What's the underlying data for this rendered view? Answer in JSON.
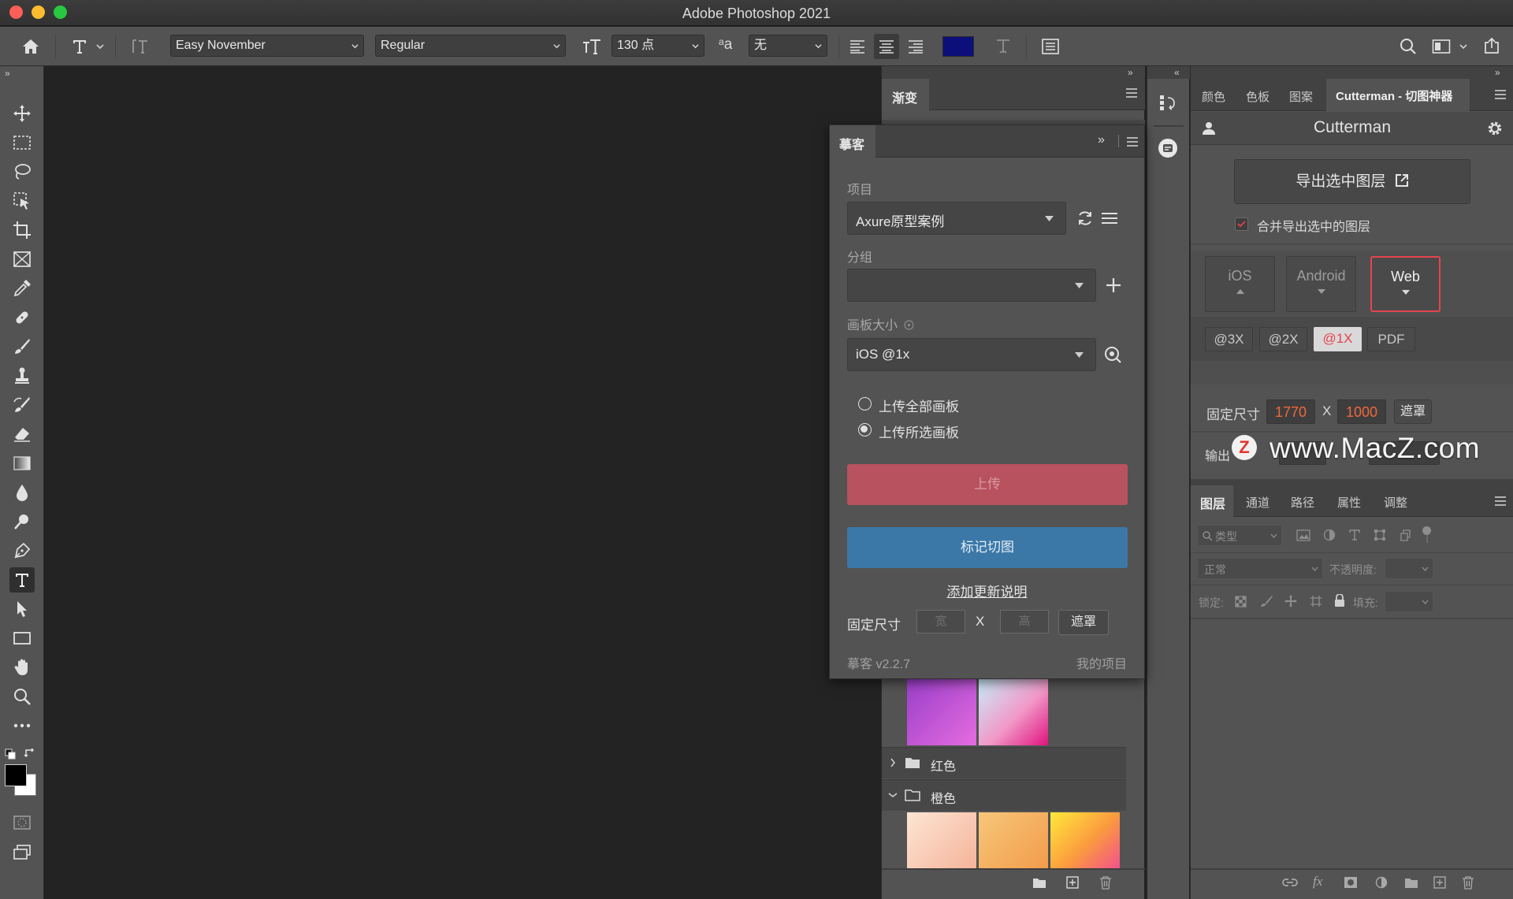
{
  "window": {
    "title": "Adobe Photoshop 2021"
  },
  "options_bar": {
    "font_family": "Easy November",
    "font_style": "Regular",
    "font_size": "130 点",
    "antialias_icon_label": "a",
    "antialias_value": "无",
    "text_color": "#0c0f7a"
  },
  "gradient_panel": {
    "tab": "渐变",
    "groups": [
      {
        "label": "红色",
        "expanded": false
      },
      {
        "label": "橙色",
        "expanded": true
      }
    ]
  },
  "moke_panel": {
    "tab": "摹客",
    "project_label": "项目",
    "project_value": "Axure原型案例",
    "group_label": "分组",
    "group_value": "",
    "artboard_label": "画板大小",
    "artboard_value": "iOS @1x",
    "radio_all": "上传全部画板",
    "radio_selected": "上传所选画板",
    "upload_button": "上传",
    "mark_button": "标记切图",
    "add_update_link": "添加更新说明",
    "fixed_size_label": "固定尺寸",
    "width_placeholder": "宽",
    "x_label": "X",
    "height_placeholder": "高",
    "mask_button": "遮罩",
    "version": "摹客 v2.2.7",
    "my_projects": "我的项目"
  },
  "right_tabs": {
    "tabs": [
      "颜色",
      "色板",
      "图案",
      "Cutterman - 切图神器"
    ]
  },
  "cutterman": {
    "title": "Cutterman",
    "export_button": "导出选中图层",
    "merge_checkbox": "合并导出选中的图层",
    "platforms": [
      "iOS",
      "Android",
      "Web"
    ],
    "active_platform": "Web",
    "scales": [
      "@3X",
      "@2X",
      "@1X",
      "PDF"
    ],
    "active_scale": "@1X",
    "fixed_size_label": "固定尺寸",
    "width_value": "1770",
    "x_label": "X",
    "height_value": "1000",
    "mask_button": "遮罩",
    "output_label": "输出",
    "watermark": "www.MacZ.com"
  },
  "layers_panel": {
    "tabs": [
      "图层",
      "通道",
      "路径",
      "属性",
      "调整"
    ],
    "filter_placeholder": "类型",
    "blend_mode": "正常",
    "opacity_label": "不透明度:",
    "lock_label": "锁定:",
    "fill_label": "填充:"
  },
  "colors": {
    "accent_red": "#e5434f",
    "orange_value": "#f0683c",
    "upload_button_bg": "#b8525f",
    "mark_button_bg": "#3b78a8"
  }
}
